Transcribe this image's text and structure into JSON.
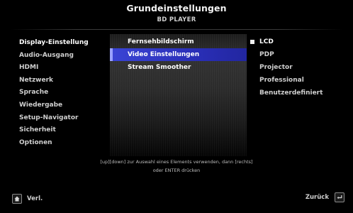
{
  "header": {
    "title": "Grundeinstellungen",
    "subtitle": "BD PLAYER"
  },
  "left_menu": {
    "items": [
      {
        "label": "Display-Einstellung",
        "active": true
      },
      {
        "label": "Audio-Ausgang",
        "active": false
      },
      {
        "label": "HDMI",
        "active": false
      },
      {
        "label": "Netzwerk",
        "active": false
      },
      {
        "label": "Sprache",
        "active": false
      },
      {
        "label": "Wiedergabe",
        "active": false
      },
      {
        "label": "Setup-Navigator",
        "active": false
      },
      {
        "label": "Sicherheit",
        "active": false
      },
      {
        "label": "Optionen",
        "active": false
      }
    ]
  },
  "center_menu": {
    "items": [
      {
        "label": "Fernsehbildschirm",
        "selected": false
      },
      {
        "label": "Video Einstellungen",
        "selected": true
      },
      {
        "label": "Stream Smoother",
        "selected": false
      }
    ]
  },
  "right_menu": {
    "items": [
      {
        "label": "LCD",
        "checked": true
      },
      {
        "label": "PDP",
        "checked": false
      },
      {
        "label": "Projector",
        "checked": false
      },
      {
        "label": "Professional",
        "checked": false
      },
      {
        "label": "Benutzerdefiniert",
        "checked": false
      }
    ]
  },
  "help": {
    "line1": "[up][down] zur Auswahl eines Elements verwenden, dann [rechts]",
    "line2": "oder ENTER drücken"
  },
  "footer": {
    "left_label": "Verl.",
    "left_icon": "home-icon",
    "right_label": "Zurück",
    "right_icon": "return-icon"
  },
  "colors": {
    "background": "#000000",
    "highlight": "#2a2fb8",
    "highlight_edge": "#9aa2ff",
    "text": "#cfcfcf"
  }
}
